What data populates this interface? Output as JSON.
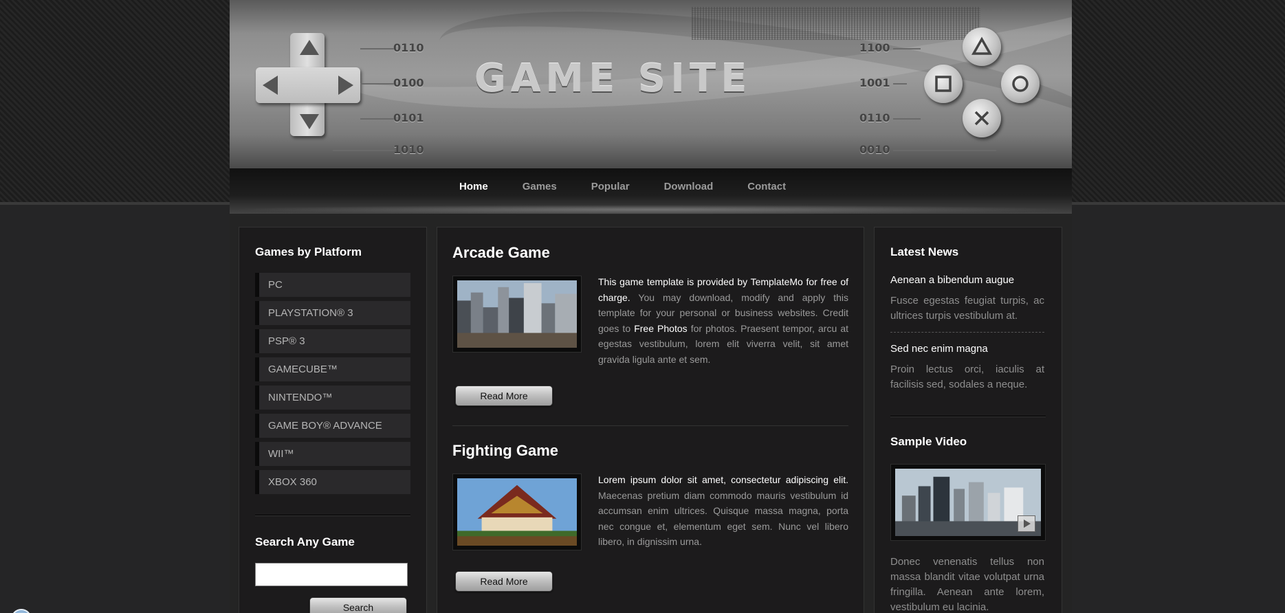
{
  "header": {
    "site_title": "GAME SITE",
    "binary_left": [
      "0110",
      "0100",
      "0101",
      "1010"
    ],
    "binary_right": [
      "1100",
      "1001",
      "0110",
      "0010"
    ]
  },
  "nav": {
    "items": [
      "Home",
      "Games",
      "Popular",
      "Download",
      "Contact"
    ],
    "active": "Home"
  },
  "left": {
    "platforms_title": "Games by Platform",
    "platforms": [
      "PC",
      "PLAYSTATION® 3",
      "PSP® 3",
      "GAMECUBE™",
      "NINTENDO™",
      "GAME BOY® ADVANCE",
      "WII™",
      "XBOX 360"
    ],
    "search_title": "Search Any Game",
    "search_value": "",
    "search_button": "Search"
  },
  "main": {
    "posts": [
      {
        "title": "Arcade Game",
        "text_highlight_1": "This game template is provided by TemplateMo for free of charge.",
        "text_1": " You may download, modify and apply this template for your personal or business websites. Credit goes to ",
        "text_highlight_2": "Free Photos",
        "text_2": " for photos. Praesent tempor, arcu at egestas vestibulum, lorem elit viverra velit, sit amet gravida ligula ante et sem.",
        "button": "Read More"
      },
      {
        "title": "Fighting Game",
        "text_highlight_1": "Lorem ipsum dolor sit amet, consectetur adipiscing elit.",
        "text_1": " Maecenas pretium diam commodo mauris vestibulum id accumsan enim ultrices. Quisque massa magna, porta nec congue et, elementum eget sem. Nunc vel libero libero, in dignissim urna.",
        "button": "Read More"
      }
    ]
  },
  "right": {
    "news_title": "Latest News",
    "news": [
      {
        "title": "Aenean a bibendum augue",
        "text": "Fusce egestas feugiat turpis, ac ultrices turpis vestibulum at."
      },
      {
        "title": "Sed nec enim magna",
        "text": "Proin lectus orci, iaculis at facilisis sed, sodales a neque."
      }
    ],
    "video_title": "Sample Video",
    "video_text": "Donec venenatis tellus non massa blandit vitae volutpat urna fringilla. Aenean ante lorem, vestibulum eu lacinia."
  }
}
